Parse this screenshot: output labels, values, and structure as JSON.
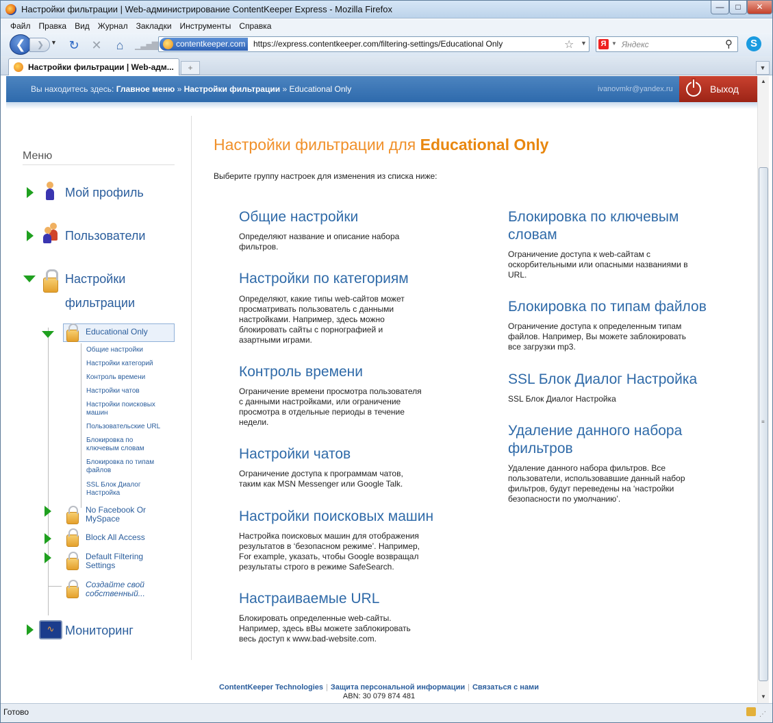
{
  "window": {
    "title": "Настройки фильтрации | Web-администрирование ContentKeeper Express - Mozilla Firefox"
  },
  "menu": [
    "Файл",
    "Правка",
    "Вид",
    "Журнал",
    "Закладки",
    "Инструменты",
    "Справка"
  ],
  "nav": {
    "site_badge": "contentkeeper.com",
    "url": "https://express.contentkeeper.com/filtering-settings/Educational Only",
    "search_placeholder": "Яндекс"
  },
  "tab": {
    "title": "Настройки фильтрации | Web-адм...",
    "new_tab": "+"
  },
  "header": {
    "breadcrumb_prefix": "Вы находитесь здесь:",
    "crumbs": [
      "Главное меню",
      "Настройки фильтрации",
      "Educational Only"
    ],
    "separator": "»",
    "user_email": "ivanovmkr@yandex.ru",
    "logout_label": "Выход"
  },
  "sidebar": {
    "title": "Меню",
    "profile": "Мой профиль",
    "users": "Пользователи",
    "filtering_line1": "Настройки",
    "filtering_line2": "фильтрации",
    "selected": "Educational Only",
    "subitems": [
      [
        "Общие настройки"
      ],
      [
        "Настройки категорий"
      ],
      [
        "Контроль времени"
      ],
      [
        "Настройки чатов"
      ],
      [
        "Настройки поисковых",
        "машин"
      ],
      [
        "Пользовательские URL"
      ],
      [
        "Блокировка по",
        "ключевым словам"
      ],
      [
        "Блокировка по типам",
        "файлов"
      ],
      [
        "SSL Блок Диалог",
        "Настройка"
      ]
    ],
    "filtersets": [
      [
        "No Facebook Or",
        "MySpace"
      ],
      [
        "Block All Access"
      ],
      [
        "Default Filtering",
        "Settings"
      ]
    ],
    "create": [
      "Создайте свой",
      "собственный..."
    ],
    "monitoring": "Мониторинг"
  },
  "main": {
    "title_prefix": "Настройки фильтрации для",
    "title_name": "Educational Only",
    "intro": "Выберите группу настроек для изменения из списка ниже:",
    "left": [
      {
        "h": [
          "Общие настройки"
        ],
        "d": [
          "Определяют название и описание набора",
          "фильтров."
        ]
      },
      {
        "h": [
          "Настройки по категориям"
        ],
        "d": [
          "Определяют, какие типы web-сайтов может",
          "просматривать пользователь с данными",
          "настройками. Например, здесь можно",
          "блокировать сайты с порнографией и",
          "азартными играми."
        ]
      },
      {
        "h": [
          "Контроль времени"
        ],
        "d": [
          "Ограничение времени просмотра пользователя",
          "с данными настройками, или ограничение",
          "просмотра в отдельные периоды в течение",
          "недели."
        ]
      },
      {
        "h": [
          "Настройки чатов"
        ],
        "d": [
          "Ограничение доступа к программам чатов,",
          "таким как MSN Messenger или Google Talk."
        ]
      },
      {
        "h": [
          "Настройки поисковых машин"
        ],
        "d": [
          "Настройка поисковых машин для отображения",
          "результатов в ‘безопасном режиме’. Например,",
          "For example, указать, чтобы Google возвращал",
          "результаты строго в режиме SafeSearch."
        ]
      },
      {
        "h": [
          "Настраиваемые URL"
        ],
        "d": [
          "Блокировать определенные web-сайты.",
          "Например, здесь вВы можете заблокировать",
          "весь доступ к www.bad-website.com."
        ]
      }
    ],
    "right": [
      {
        "h": [
          "Блокировка по ключевым",
          "словам"
        ],
        "d": [
          "Ограничение доступа к web-сайтам с",
          "оскорбительными или опасными названиями в",
          "URL."
        ]
      },
      {
        "h": [
          "Блокировка по типам файлов"
        ],
        "d": [
          "Ограничение доступа к определенным типам",
          "файлов. Например, Вы можете заблокировать",
          "все загрузки mp3."
        ]
      },
      {
        "h": [
          "SSL Блок Диалог Настройка"
        ],
        "d": [
          "SSL Блок Диалог Настройка"
        ]
      },
      {
        "h": [
          "Удаление данного набора",
          "фильтров"
        ],
        "d": [
          "Удаление данного набора фильтров. Все",
          "пользователи, использовавшие данный набор",
          "фильтров, будут переведены на ‘настройки",
          "безопасности по умолчанию’."
        ]
      }
    ]
  },
  "footer": {
    "links": [
      "ContentKeeper Technologies",
      "Защита персональной информации",
      "Связаться с нами"
    ],
    "separator": "|",
    "abn": "ABN: 30 079 874 481"
  },
  "status": {
    "text": "Готово"
  },
  "colors": {
    "accent_orange": "#f0902a",
    "link_blue": "#2f6aa8",
    "header_blue": "#3a75b5",
    "logout_red": "#b5321f",
    "tree_green": "#1fa01f"
  }
}
